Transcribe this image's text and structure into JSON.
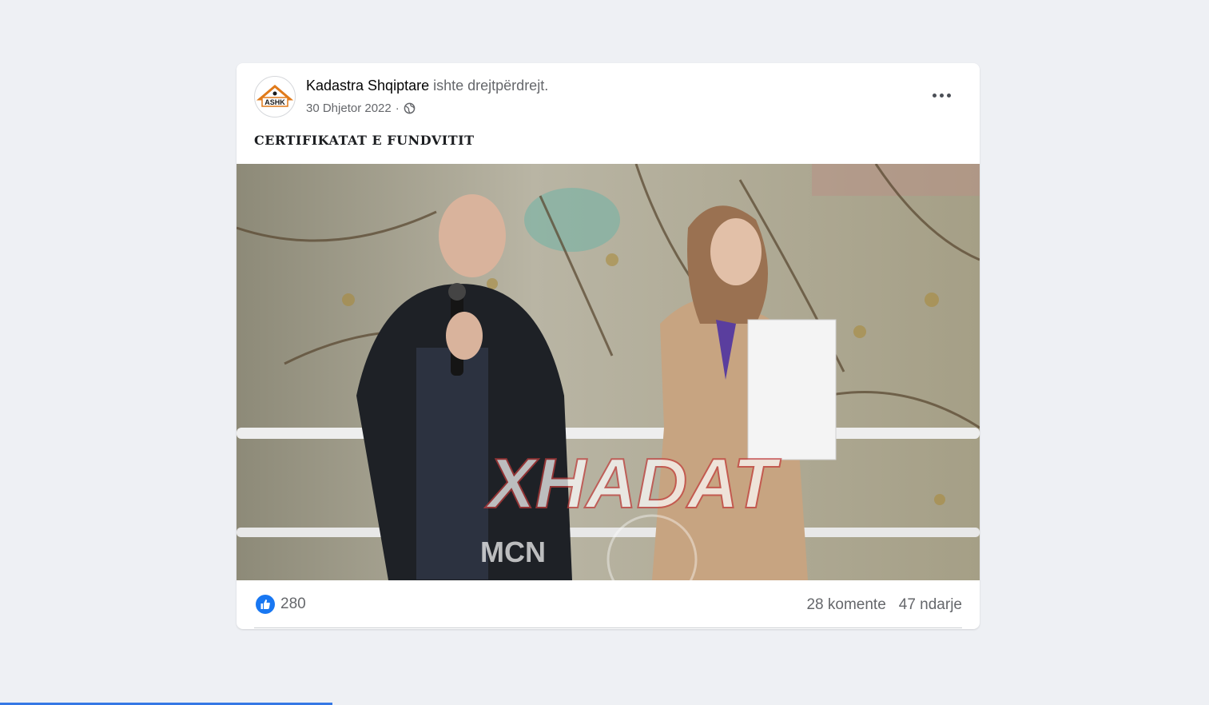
{
  "post": {
    "author_name": "Kadastra Shqiptare",
    "author_status": "ishte drejtpërdrejt.",
    "date": "30 Dhjetor 2022",
    "separator": "·",
    "privacy_icon": "globe-icon",
    "avatar_text": "ASHK",
    "text": "CERTIFIKATAT E FUNDVITIT",
    "media": {
      "description_icon": "video-frame",
      "watermark_main": "XHADAT",
      "watermark_sub": "MCN"
    },
    "reactions": {
      "icon": "like-icon",
      "count": "280"
    },
    "comments": "28 komente",
    "shares": "47 ndarje",
    "more_icon": "more-horizontal-icon"
  },
  "colors": {
    "accent": "#1877f2",
    "text_secondary": "#65676b",
    "page_bg": "#eef0f4"
  }
}
